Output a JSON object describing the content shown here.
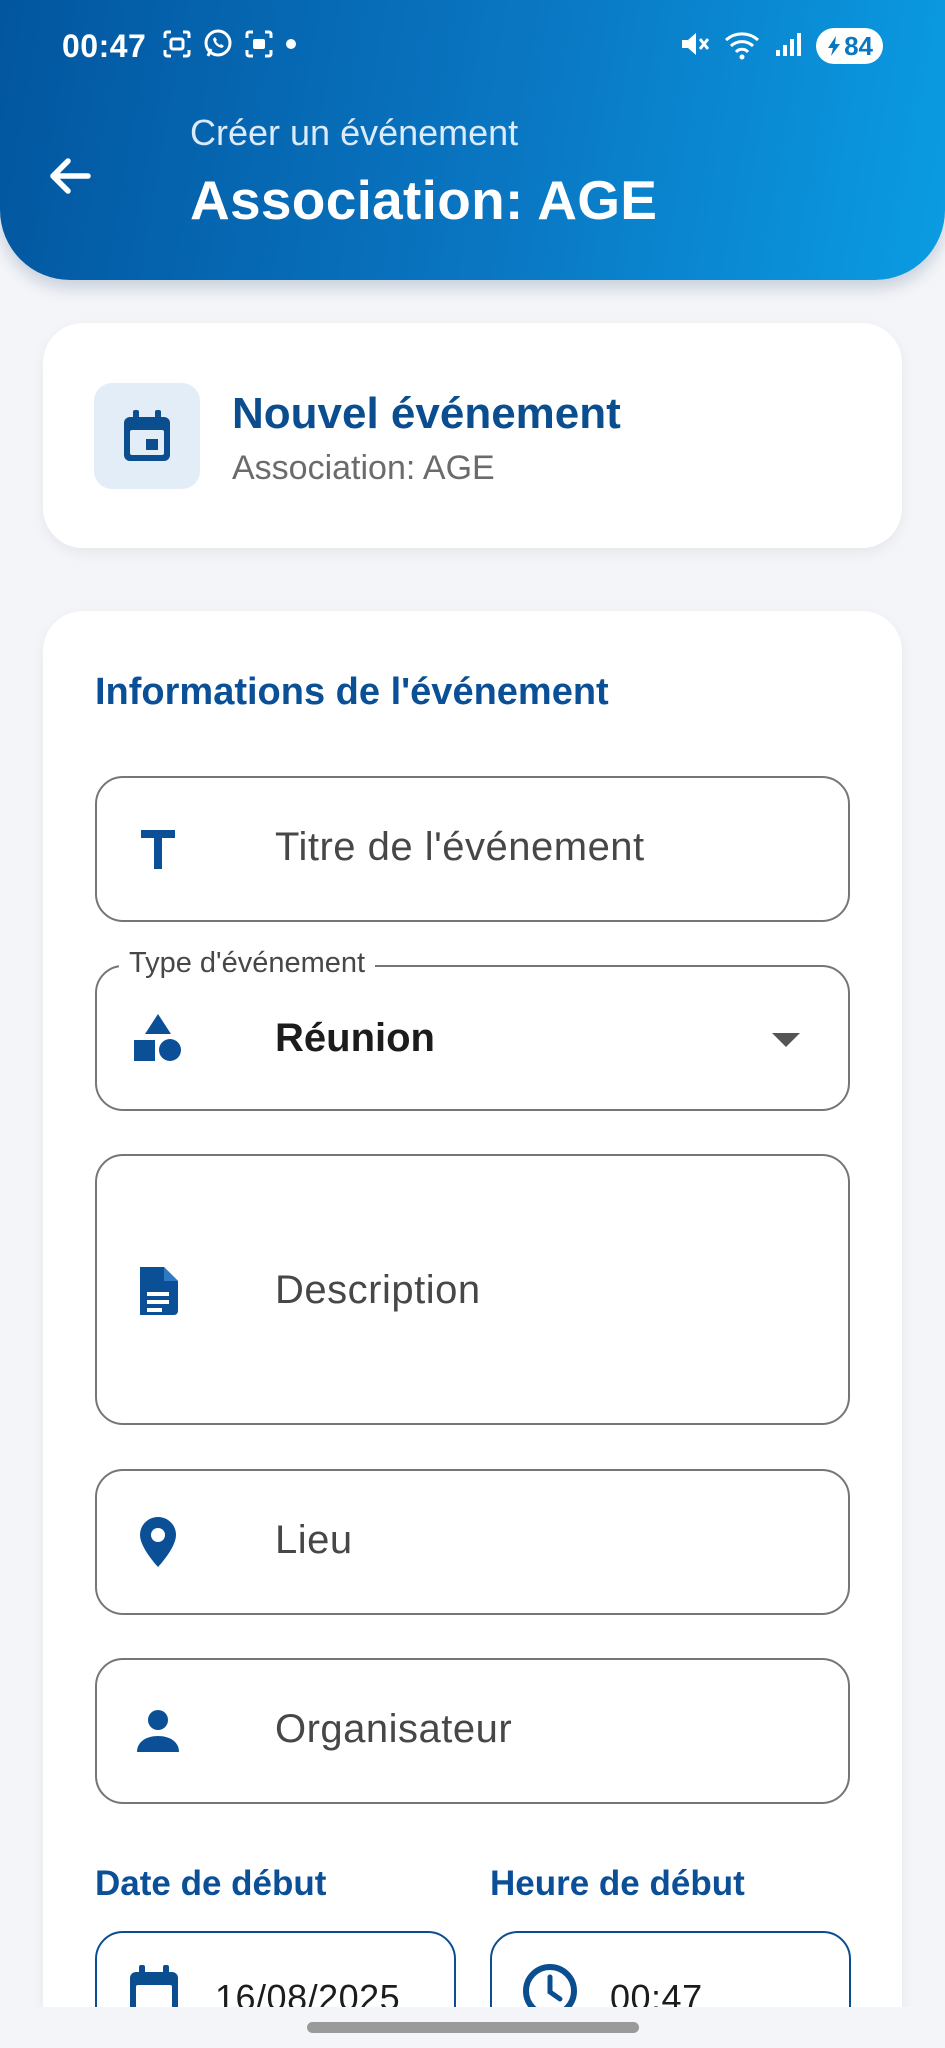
{
  "status_bar": {
    "time": "00:47",
    "battery": "84",
    "icons": [
      "screenshot-icon",
      "whatsapp-icon",
      "screen-record-icon",
      "dot-icon",
      "mute-icon",
      "wifi-icon",
      "signal-icon",
      "battery-icon"
    ]
  },
  "header": {
    "subtitle": "Créer un événement",
    "title": "Association: AGE",
    "back_icon": "arrow-back-icon"
  },
  "summary_card": {
    "title": "Nouvel événement",
    "subtitle": "Association: AGE",
    "icon": "calendar-icon"
  },
  "form": {
    "section_title": "Informations de l'événement",
    "title_field": {
      "placeholder": "Titre de l'événement",
      "icon": "title-icon"
    },
    "type_field": {
      "label": "Type d'événement",
      "value": "Réunion",
      "icon": "category-icon"
    },
    "description_field": {
      "placeholder": "Description",
      "icon": "document-icon"
    },
    "location_field": {
      "placeholder": "Lieu",
      "icon": "location-pin-icon"
    },
    "organizer_field": {
      "placeholder": "Organisateur",
      "icon": "person-icon"
    },
    "start_date": {
      "label": "Date de début",
      "value": "16/08/2025",
      "icon": "calendar-icon"
    },
    "start_time": {
      "label": "Heure de début",
      "value": "00:47",
      "icon": "clock-icon"
    }
  },
  "colors": {
    "primary": "#0B5097",
    "header_gradient_start": "#02569F",
    "header_gradient_end": "#0A9CE2",
    "background": "#F3F5F8",
    "icon_tile": "#E3EDF7"
  }
}
